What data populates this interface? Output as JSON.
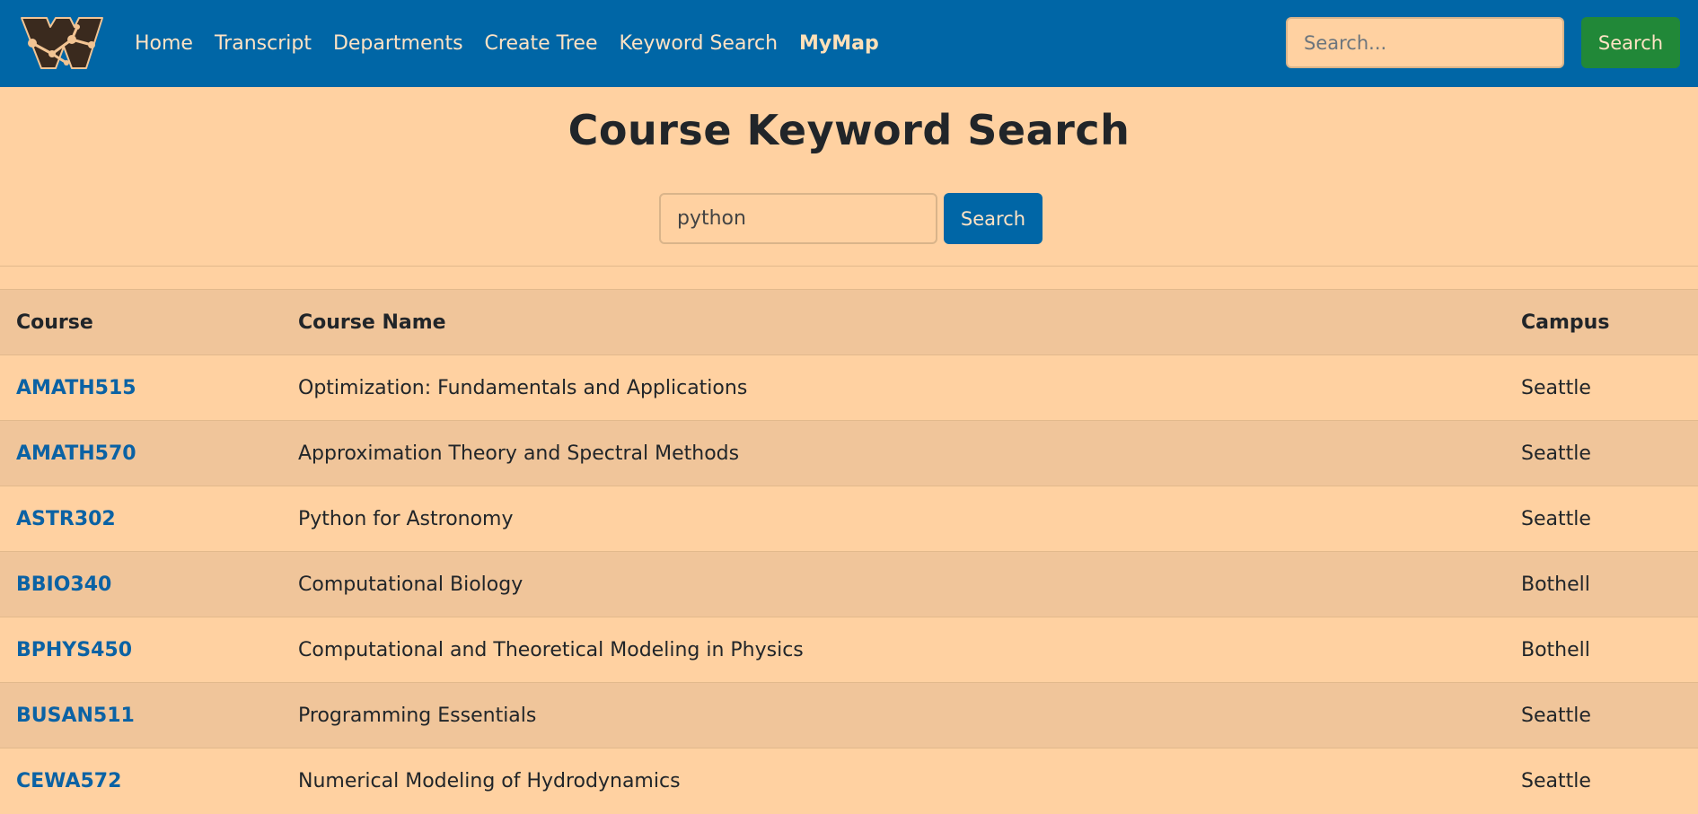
{
  "navbar": {
    "logo_icon": "w-tree-logo-icon",
    "links": [
      {
        "label": "Home",
        "active": false
      },
      {
        "label": "Transcript",
        "active": false
      },
      {
        "label": "Departments",
        "active": false
      },
      {
        "label": "Create Tree",
        "active": false
      },
      {
        "label": "Keyword Search",
        "active": false
      },
      {
        "label": "MyMap",
        "active": true
      }
    ],
    "search": {
      "placeholder": "Search...",
      "button_label": "Search"
    }
  },
  "main": {
    "title": "Course Keyword Search",
    "search": {
      "value": "python",
      "button_label": "Search"
    }
  },
  "table": {
    "headers": {
      "course": "Course",
      "name": "Course Name",
      "campus": "Campus"
    },
    "rows": [
      {
        "course": "AMATH515",
        "name": "Optimization: Fundamentals and Applications",
        "campus": "Seattle"
      },
      {
        "course": "AMATH570",
        "name": "Approximation Theory and Spectral Methods",
        "campus": "Seattle"
      },
      {
        "course": "ASTR302",
        "name": "Python for Astronomy",
        "campus": "Seattle"
      },
      {
        "course": "BBIO340",
        "name": "Computational Biology",
        "campus": "Bothell"
      },
      {
        "course": "BPHYS450",
        "name": "Computational and Theoretical Modeling in Physics",
        "campus": "Bothell"
      },
      {
        "course": "BUSAN511",
        "name": "Programming Essentials",
        "campus": "Seattle"
      },
      {
        "course": "CEWA572",
        "name": "Numerical Modeling of Hydrodynamics",
        "campus": "Seattle"
      }
    ]
  },
  "colors": {
    "navbar": "#0066a6",
    "page_background": "#ffd1a1",
    "stripe": "#f0c59a",
    "search_green": "#218838",
    "link_blue": "#0b62a4"
  }
}
